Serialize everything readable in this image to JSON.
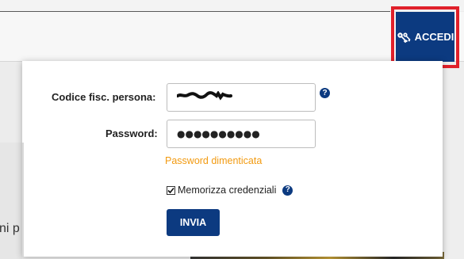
{
  "header": {
    "login_button_label": "ACCEDI",
    "login_icon": "keys-icon",
    "highlight_color": "#e0202a",
    "brand_color": "#0c3a80"
  },
  "background": {
    "partial_text": "ni p"
  },
  "login_form": {
    "fiscal_code_label": "Codice fisc. persona:",
    "fiscal_code_value_masked": true,
    "password_label": "Password:",
    "password_value": "●●●●●●●●●●",
    "forgot_password_link": "Password dimenticata",
    "remember_label": "Memorizza credenziali",
    "remember_checked": true,
    "submit_label": "INVIA",
    "help_icon_glyph": "?",
    "link_color": "#f29a10"
  }
}
